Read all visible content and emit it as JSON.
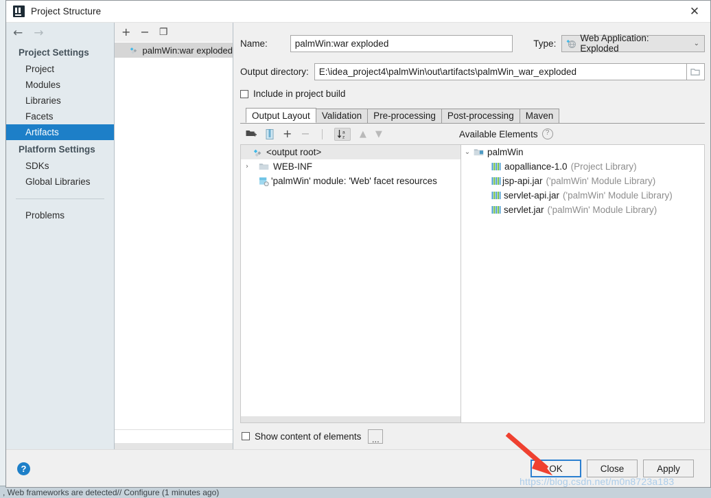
{
  "window": {
    "title": "Project Structure",
    "close_label": "✕",
    "app_icon": "intellij-idea-logo"
  },
  "background": {
    "status_text": ", Web frameworks are detected// Configure (1 minutes ago)"
  },
  "nav": {
    "back_label": "←",
    "forward_label": "→",
    "groups": [
      {
        "label": "Project Settings",
        "items": [
          {
            "label": "Project",
            "selected": false
          },
          {
            "label": "Modules",
            "selected": false
          },
          {
            "label": "Libraries",
            "selected": false
          },
          {
            "label": "Facets",
            "selected": false
          },
          {
            "label": "Artifacts",
            "selected": true
          }
        ]
      },
      {
        "label": "Platform Settings",
        "items": [
          {
            "label": "SDKs",
            "selected": false
          },
          {
            "label": "Global Libraries",
            "selected": false
          }
        ]
      }
    ],
    "problems_label": "Problems"
  },
  "artifacts_panel": {
    "toolbar": {
      "add_label": "+",
      "remove_label": "−",
      "copy_label": "❐"
    },
    "items": [
      {
        "label": "palmWin:war exploded",
        "selected": true,
        "icon": "artifact-icon"
      }
    ]
  },
  "form": {
    "name_label": "Name:",
    "name_value": "palmWin:war exploded",
    "name_placeholder": "",
    "type_label": "Type:",
    "type_value": "Web Application: Exploded",
    "type_icon": "web-application-icon",
    "type_caret": "⌄",
    "output_dir_label": "Output directory:",
    "output_dir_value": "E:\\idea_project4\\palmWin\\out\\artifacts\\palmWin_war_exploded",
    "browse_icon": "folder-icon",
    "include_in_build_label": "Include in project build",
    "include_in_build_checked": false
  },
  "tabs": [
    {
      "label": "Output Layout",
      "active": true
    },
    {
      "label": "Validation",
      "active": false
    },
    {
      "label": "Pre-processing",
      "active": false
    },
    {
      "label": "Post-processing",
      "active": false
    },
    {
      "label": "Maven",
      "active": false
    }
  ],
  "tree_toolbar": {
    "create_dir_label": "create-directory-icon",
    "create_archive_label": "create-archive-icon",
    "add_label": "+",
    "remove_label": "−",
    "sort_label": "sort-alphabetically-icon",
    "move_up_label": "▲",
    "move_down_label": "▼"
  },
  "available_elements": {
    "header": "Available Elements",
    "help_label": "?"
  },
  "output_layout_tree": [
    {
      "label": "<output root>",
      "icon": "artifact-icon",
      "indent": 0,
      "twisty": "",
      "selected": true,
      "suffix": ""
    },
    {
      "label": "WEB-INF",
      "icon": "folder-icon",
      "indent": 1,
      "twisty": "›",
      "selected": false,
      "suffix": ""
    },
    {
      "label": "'palmWin' module: 'Web' facet resources",
      "icon": "facet-icon",
      "indent": 1,
      "twisty": "",
      "selected": false,
      "suffix": ""
    }
  ],
  "available_tree": [
    {
      "label": "palmWin",
      "icon": "module-icon",
      "indent": 0,
      "twisty": "⌄",
      "suffix": ""
    },
    {
      "label": "aopalliance-1.0",
      "icon": "library-icon",
      "indent": 1,
      "twisty": "",
      "suffix": "(Project Library)"
    },
    {
      "label": "jsp-api.jar",
      "icon": "library-icon",
      "indent": 1,
      "twisty": "",
      "suffix": "('palmWin' Module Library)"
    },
    {
      "label": "servlet-api.jar",
      "icon": "library-icon",
      "indent": 1,
      "twisty": "",
      "suffix": "('palmWin' Module Library)"
    },
    {
      "label": "servlet.jar",
      "icon": "library-icon",
      "indent": 1,
      "twisty": "",
      "suffix": "('palmWin' Module Library)"
    }
  ],
  "footer": {
    "show_content_label": "Show content of elements",
    "show_content_checked": false,
    "dots_label": "...",
    "help_label": "?",
    "ok_label": "OK",
    "close_label": "Close",
    "apply_label": "Apply"
  },
  "annotation": {
    "arrow_color": "#ef4130",
    "watermark_text": "https://blog.csdn.net/m0n8723a183"
  },
  "colors": {
    "accent": "#1d7fc8",
    "dialog_bg": "#f0f0f0",
    "nav_bg": "#e3eaee",
    "selection": "#1d7fc8"
  }
}
